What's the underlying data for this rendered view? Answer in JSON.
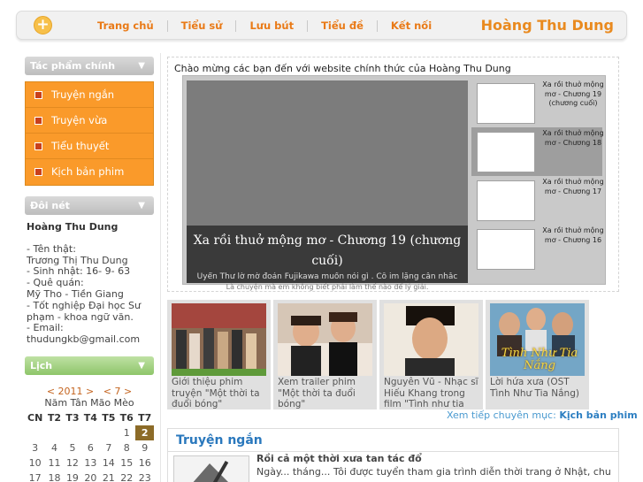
{
  "header": {
    "home_icon": "plus-circle-icon",
    "nav": [
      "Trang chủ",
      "Tiểu sử",
      "Lưu bút",
      "Tiểu đề",
      "Kết nối"
    ],
    "brand": "Hoàng Thu Dung"
  },
  "sidebar": {
    "works_title": "Tác phẩm chính",
    "works": [
      "Truyện ngắn",
      "Truyện vừa",
      "Tiểu thuyết",
      "Kịch bản phim"
    ],
    "bio_title": "Đôi nét",
    "bio": {
      "name": "Hoàng Thu Dung",
      "lines": [
        "- Tên thật:",
        "Trương Thị Thu Dung",
        "- Sinh nhật: 16- 9- 63",
        "- Quê quán:",
        "Mỹ Tho - Tiền Giang",
        "- Tốt nghiệp Đại học Sư",
        "phạm - khoa ngữ văn.",
        "- Email:",
        "thudungkb@gmail.com"
      ]
    },
    "cal_title": "Lịch",
    "calendar": {
      "year_nav": "< 2011 >",
      "month_nav": "< 7 >",
      "lunar": "Năm Tân Mão Mèo",
      "weekdays": [
        "CN",
        "T2",
        "T3",
        "T4",
        "T5",
        "T6",
        "T7"
      ],
      "weeks": [
        [
          "",
          "",
          "",
          "",
          "",
          "1",
          "2"
        ],
        [
          "3",
          "4",
          "5",
          "6",
          "7",
          "8",
          "9"
        ],
        [
          "10",
          "11",
          "12",
          "13",
          "14",
          "15",
          "16"
        ],
        [
          "17",
          "18",
          "19",
          "20",
          "21",
          "22",
          "23"
        ]
      ],
      "today": "2"
    }
  },
  "feature": {
    "welcome": "Chào mừng các bạn đến với website chính thức của Hoàng Thu Dung",
    "main_title": "Xa rồi thuở mộng mơ - Chương 19 (chương cuối)",
    "main_text": "Uyển Thư lờ mờ đoán Fujikawa muốn nói gì . Cô im lặng cân nhắc",
    "main_text2": "Là chuyện mà em không biết phải làm thế nào để lý giải.",
    "thumbs": [
      "Xa rồi thuở mộng mơ - Chương 19 (chương cuối)",
      "Xa rồi thuở mộng mơ - Chương 18",
      "Xa rồi thuở mộng mơ - Chương 17",
      "Xa rồi thuở mộng mơ - Chương 16"
    ]
  },
  "gallery": [
    {
      "caption": "Giới thiệu phim truyện \"Một thời ta đuổi bóng\""
    },
    {
      "caption": "Xem trailer phim \"Một thời ta đuổi bóng\""
    },
    {
      "caption": "Nguyên Vũ - Nhạc sĩ Hiếu Khang trong film \"Tình như tia nắng\""
    },
    {
      "caption": "Lời hứa xưa (OST Tình Như Tia Nắng)"
    }
  ],
  "gallery_badge": "Tình Như Tia Nắng",
  "more": {
    "prefix": "Xem tiếp chuyên mục: ",
    "link": "Kịch bản phim"
  },
  "section": {
    "title": "Truyện ngắn",
    "article_title": "Rồi cả một thời xưa tan tác đổ",
    "article_desc": "Ngày... tháng... Tôi được tuyển tham gia trình diễn thời trang ở Nhật, chuyến lưu"
  },
  "colors": {
    "accent": "#e97a17",
    "menu": "#fa9a2a",
    "link": "#2a78bd"
  }
}
